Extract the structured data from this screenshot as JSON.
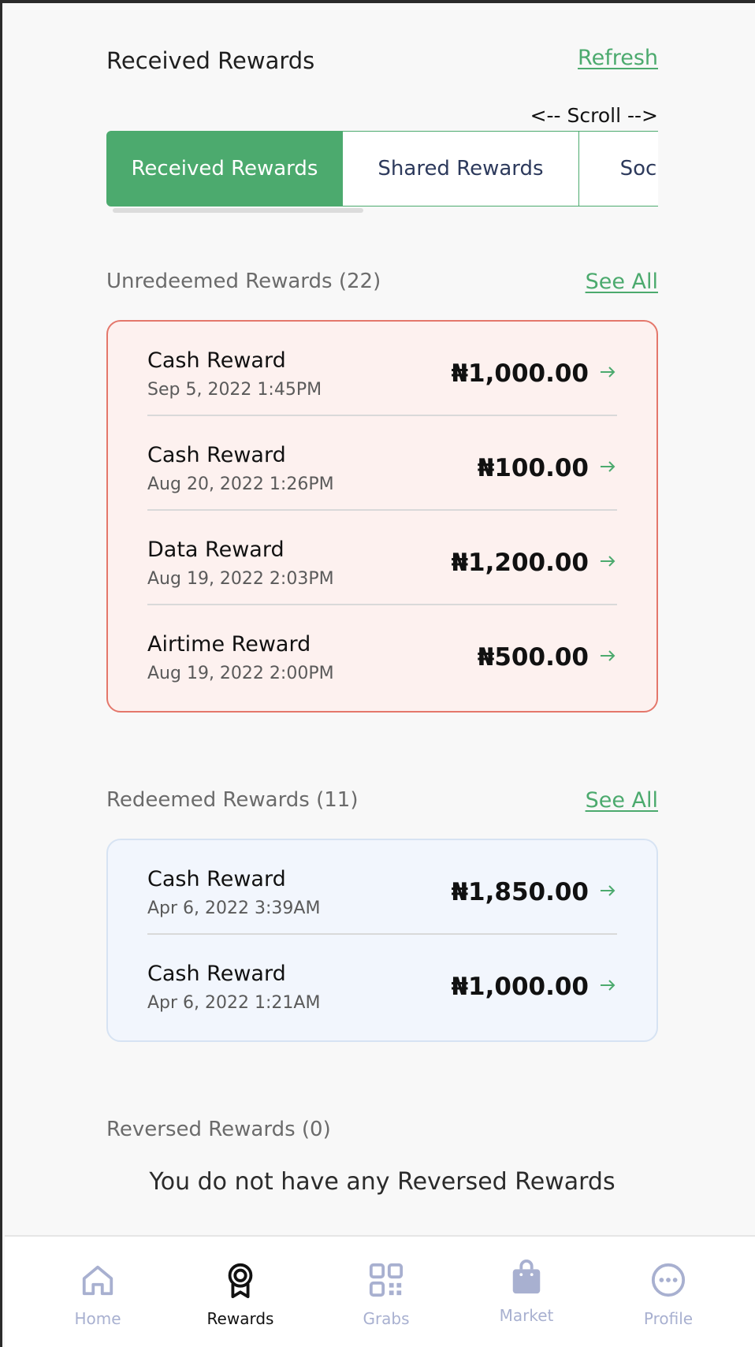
{
  "header": {
    "title": "Received Rewards",
    "refresh_label": "Refresh"
  },
  "scroll_hint": "<-- Scroll -->",
  "tabs": [
    {
      "label": "Received Rewards",
      "active": true
    },
    {
      "label": "Shared Rewards",
      "active": false
    },
    {
      "label": "Social Rewards",
      "active": false
    }
  ],
  "unredeemed": {
    "title": "Unredeemed Rewards (22)",
    "see_all": "See All",
    "items": [
      {
        "title": "Cash Reward",
        "date": "Sep 5, 2022 1:45PM",
        "amount": "₦1,000.00"
      },
      {
        "title": "Cash Reward",
        "date": "Aug 20, 2022 1:26PM",
        "amount": "₦100.00"
      },
      {
        "title": "Data Reward",
        "date": "Aug 19, 2022 2:03PM",
        "amount": "₦1,200.00"
      },
      {
        "title": "Airtime Reward",
        "date": "Aug 19, 2022 2:00PM",
        "amount": "₦500.00"
      }
    ]
  },
  "redeemed": {
    "title": "Redeemed Rewards (11)",
    "see_all": "See All",
    "items": [
      {
        "title": "Cash Reward",
        "date": "Apr 6, 2022 3:39AM",
        "amount": "₦1,850.00"
      },
      {
        "title": "Cash Reward",
        "date": "Apr 6, 2022 1:21AM",
        "amount": "₦1,000.00"
      }
    ]
  },
  "reversed": {
    "title": "Reversed Rewards (0)",
    "empty_message": "You do not have any Reversed Rewards"
  },
  "nav": [
    {
      "label": "Home",
      "icon": "home-icon",
      "active": false
    },
    {
      "label": "Rewards",
      "icon": "award-icon",
      "active": true
    },
    {
      "label": "Grabs",
      "icon": "qr-code-icon",
      "active": false
    },
    {
      "label": "Market",
      "icon": "shopping-bag-icon",
      "active": false
    },
    {
      "label": "Profile",
      "icon": "more-horizontal-icon",
      "active": false
    }
  ],
  "colors": {
    "accent": "#4caa6e",
    "unredeemed_bg": "#fdf1ef",
    "unredeemed_border": "#e4776b",
    "redeemed_bg": "#f2f6fd",
    "nav_inactive": "#a8b0d0"
  }
}
